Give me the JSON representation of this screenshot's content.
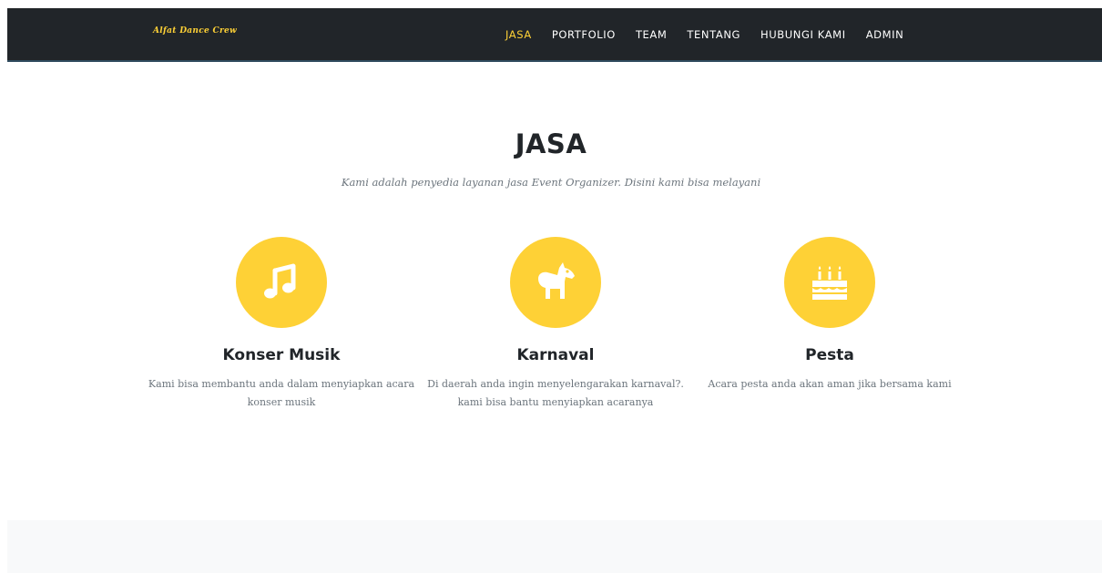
{
  "navbar": {
    "brand": "Alfat Dance Crew",
    "links": [
      {
        "label": "JASA",
        "active": true
      },
      {
        "label": "PORTFOLIO",
        "active": false
      },
      {
        "label": "TEAM",
        "active": false
      },
      {
        "label": "TENTANG",
        "active": false
      },
      {
        "label": "HUBUNGI KAMI",
        "active": false
      },
      {
        "label": "ADMIN",
        "active": false
      }
    ]
  },
  "services": {
    "title": "JASA",
    "subtitle": "Kami adalah penyedia layanan jasa Event Organizer. Disini kami bisa melayani",
    "items": [
      {
        "icon": "music-icon",
        "title": "Konser Musik",
        "text": "Kami bisa membantu anda dalam menyiapkan acara konser musik"
      },
      {
        "icon": "horse-icon",
        "title": "Karnaval",
        "text": "Di daerah anda ingin menyelengarakan karnaval?. kami bisa bantu menyiapkan acaranya"
      },
      {
        "icon": "birthday-cake-icon",
        "title": "Pesta",
        "text": "Acara pesta anda akan aman jika bersama kami"
      }
    ]
  },
  "colors": {
    "navbar_bg": "#212529",
    "accent": "#fed136",
    "heading": "#212529",
    "muted_text": "#6c757d",
    "footer_band_bg": "#f8f9fa"
  }
}
